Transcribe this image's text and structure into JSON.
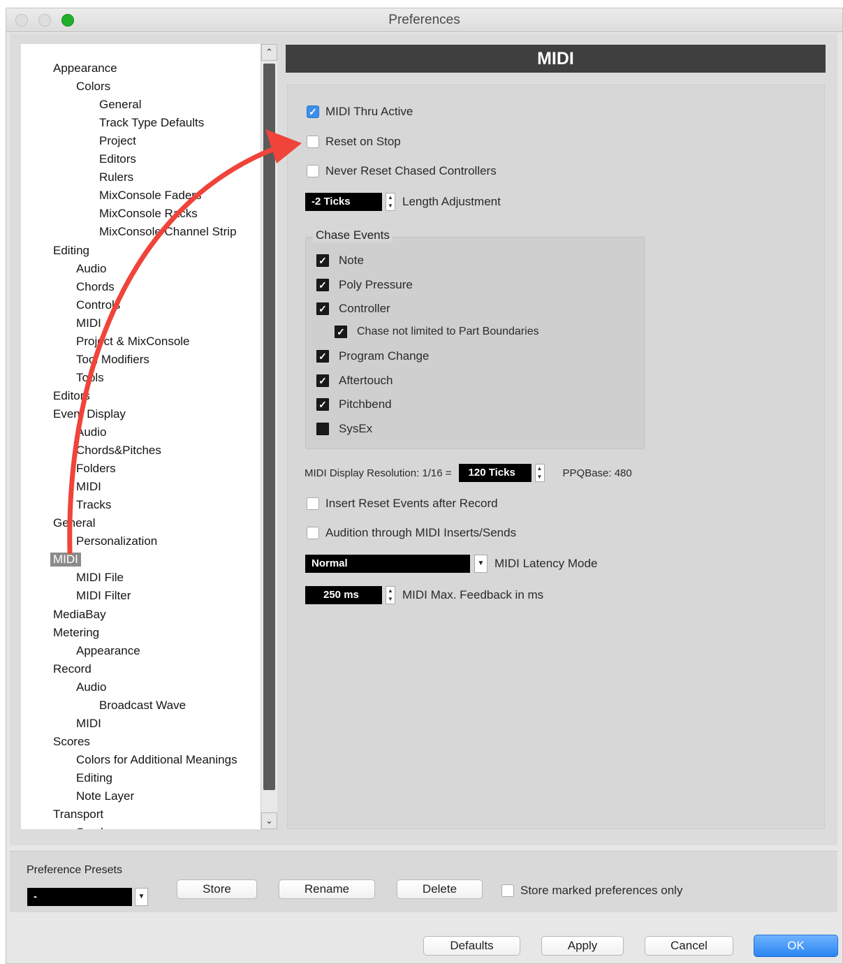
{
  "window": {
    "title": "Preferences"
  },
  "tree": {
    "items": [
      {
        "label": "Appearance",
        "indent": 0
      },
      {
        "label": "Colors",
        "indent": 1
      },
      {
        "label": "General",
        "indent": 2
      },
      {
        "label": "Track Type Defaults",
        "indent": 2
      },
      {
        "label": "Project",
        "indent": 2
      },
      {
        "label": "Editors",
        "indent": 2
      },
      {
        "label": "Rulers",
        "indent": 2
      },
      {
        "label": "MixConsole Faders",
        "indent": 2
      },
      {
        "label": "MixConsole Racks",
        "indent": 2
      },
      {
        "label": "MixConsole Channel Strip",
        "indent": 2
      },
      {
        "label": "Editing",
        "indent": 0
      },
      {
        "label": "Audio",
        "indent": 1
      },
      {
        "label": "Chords",
        "indent": 1
      },
      {
        "label": "Controls",
        "indent": 1
      },
      {
        "label": "MIDI",
        "indent": 1
      },
      {
        "label": "Project & MixConsole",
        "indent": 1
      },
      {
        "label": "Tool Modifiers",
        "indent": 1
      },
      {
        "label": "Tools",
        "indent": 1
      },
      {
        "label": "Editors",
        "indent": 0
      },
      {
        "label": "Event Display",
        "indent": 0
      },
      {
        "label": "Audio",
        "indent": 1
      },
      {
        "label": "Chords&Pitches",
        "indent": 1
      },
      {
        "label": "Folders",
        "indent": 1
      },
      {
        "label": "MIDI",
        "indent": 1
      },
      {
        "label": "Tracks",
        "indent": 1
      },
      {
        "label": "General",
        "indent": 0
      },
      {
        "label": "Personalization",
        "indent": 1
      },
      {
        "label": "MIDI",
        "indent": 0,
        "selected": true
      },
      {
        "label": "MIDI File",
        "indent": 1
      },
      {
        "label": "MIDI Filter",
        "indent": 1
      },
      {
        "label": "MediaBay",
        "indent": 0
      },
      {
        "label": "Metering",
        "indent": 0
      },
      {
        "label": "Appearance",
        "indent": 1
      },
      {
        "label": "Record",
        "indent": 0
      },
      {
        "label": "Audio",
        "indent": 1
      },
      {
        "label": "Broadcast Wave",
        "indent": 2
      },
      {
        "label": "MIDI",
        "indent": 1
      },
      {
        "label": "Scores",
        "indent": 0
      },
      {
        "label": "Colors for Additional Meanings",
        "indent": 1
      },
      {
        "label": "Editing",
        "indent": 1
      },
      {
        "label": "Note Layer",
        "indent": 1
      },
      {
        "label": "Transport",
        "indent": 0
      },
      {
        "label": "Scrub",
        "indent": 1
      }
    ]
  },
  "panel": {
    "title": "MIDI",
    "midi_thru_active": "MIDI Thru Active",
    "reset_on_stop": "Reset on Stop",
    "never_reset": "Never Reset Chased Controllers",
    "length_value": "-2 Ticks",
    "length_label": "Length Adjustment",
    "chase": {
      "title": "Chase Events",
      "items": [
        {
          "label": "Note",
          "checked": true
        },
        {
          "label": "Poly Pressure",
          "checked": true
        },
        {
          "label": "Controller",
          "checked": true
        },
        {
          "label": "Chase not limited to Part Boundaries",
          "checked": true,
          "sub": true
        },
        {
          "label": "Program Change",
          "checked": true
        },
        {
          "label": "Aftertouch",
          "checked": true
        },
        {
          "label": "Pitchbend",
          "checked": true
        },
        {
          "label": "SysEx",
          "checked": false
        }
      ]
    },
    "display_res_label": "MIDI Display Resolution: 1/16 =",
    "display_res_value": "120 Ticks",
    "ppq": "PPQBase: 480",
    "insert_reset": "Insert Reset Events after Record",
    "audition": "Audition through MIDI Inserts/Sends",
    "latency_value": "Normal",
    "latency_label": "MIDI Latency Mode",
    "feedback_value": "250 ms",
    "feedback_label": "MIDI Max. Feedback in ms"
  },
  "presets": {
    "label": "Preference Presets",
    "value": "-",
    "store": "Store",
    "rename": "Rename",
    "delete": "Delete",
    "marked_only": "Store marked preferences only"
  },
  "buttons": {
    "defaults": "Defaults",
    "apply": "Apply",
    "cancel": "Cancel",
    "ok": "OK"
  },
  "colors": {
    "annotation_arrow": "#f0443a",
    "ok_button": "#2a85f2",
    "header": "#3f3f3f"
  }
}
